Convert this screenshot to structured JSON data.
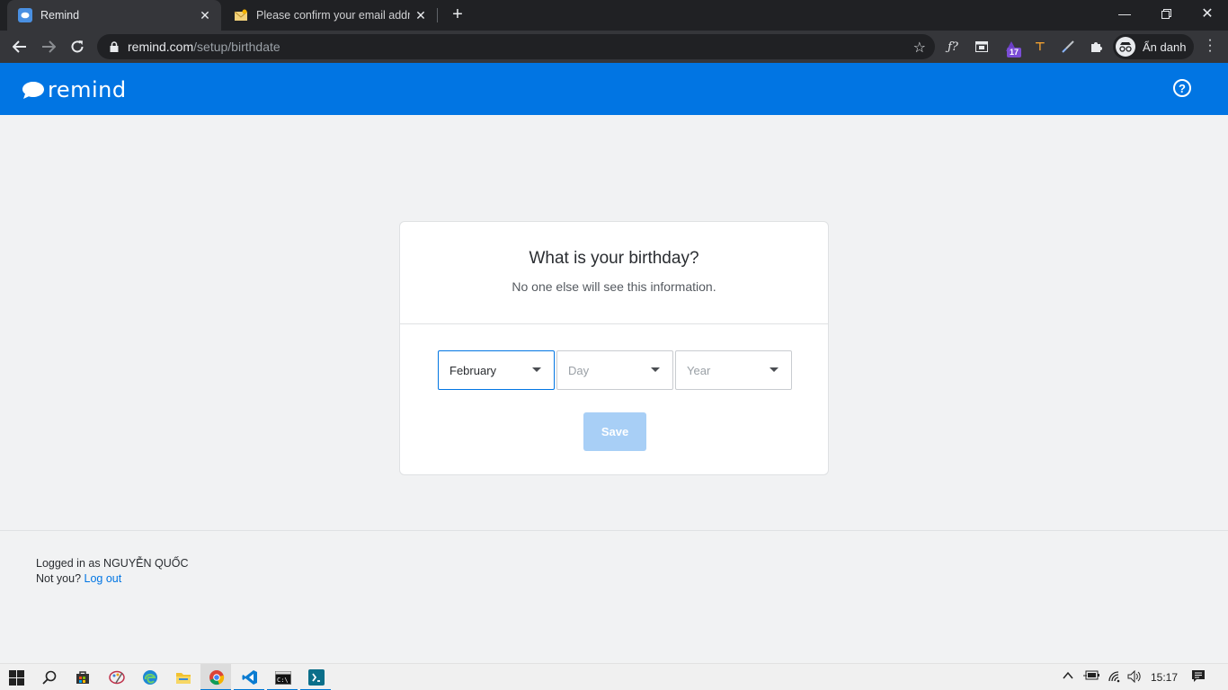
{
  "browser": {
    "tabs": [
      {
        "title": "Remind",
        "icon": "remind-favicon"
      },
      {
        "title": "Please confirm your email address",
        "icon": "mail-favicon"
      }
    ],
    "url_host": "remind.com",
    "url_path": "/setup/birthdate",
    "extensions": [
      "formula-icon",
      "window-icon",
      "purple-extension-icon",
      "pickaxe-icon",
      "brush-icon",
      "puzzle-icon"
    ],
    "extension_badge": "17",
    "profile_label": "Ẩn danh"
  },
  "app": {
    "logo_text": "remind",
    "brand_color": "#0175e3"
  },
  "card": {
    "title": "What is your birthday?",
    "subtitle": "No one else will see this information.",
    "month": {
      "value": "February"
    },
    "day": {
      "placeholder": "Day"
    },
    "year": {
      "placeholder": "Year"
    },
    "save_label": "Save"
  },
  "footer": {
    "logged_in_text": "Logged in as NGUYỄN QUỐC",
    "not_you_text": "Not you?",
    "logout_label": "Log out"
  },
  "taskbar": {
    "apps": [
      "windows-start-icon",
      "search-icon",
      "store-icon",
      "paint-icon",
      "edge-icon",
      "file-explorer-icon",
      "chrome-icon",
      "vscode-icon",
      "terminal-icon",
      "code-editor-icon"
    ],
    "active_apps": [
      "chrome-icon",
      "vscode-icon",
      "terminal-icon",
      "code-editor-icon"
    ],
    "time": "15:17"
  }
}
